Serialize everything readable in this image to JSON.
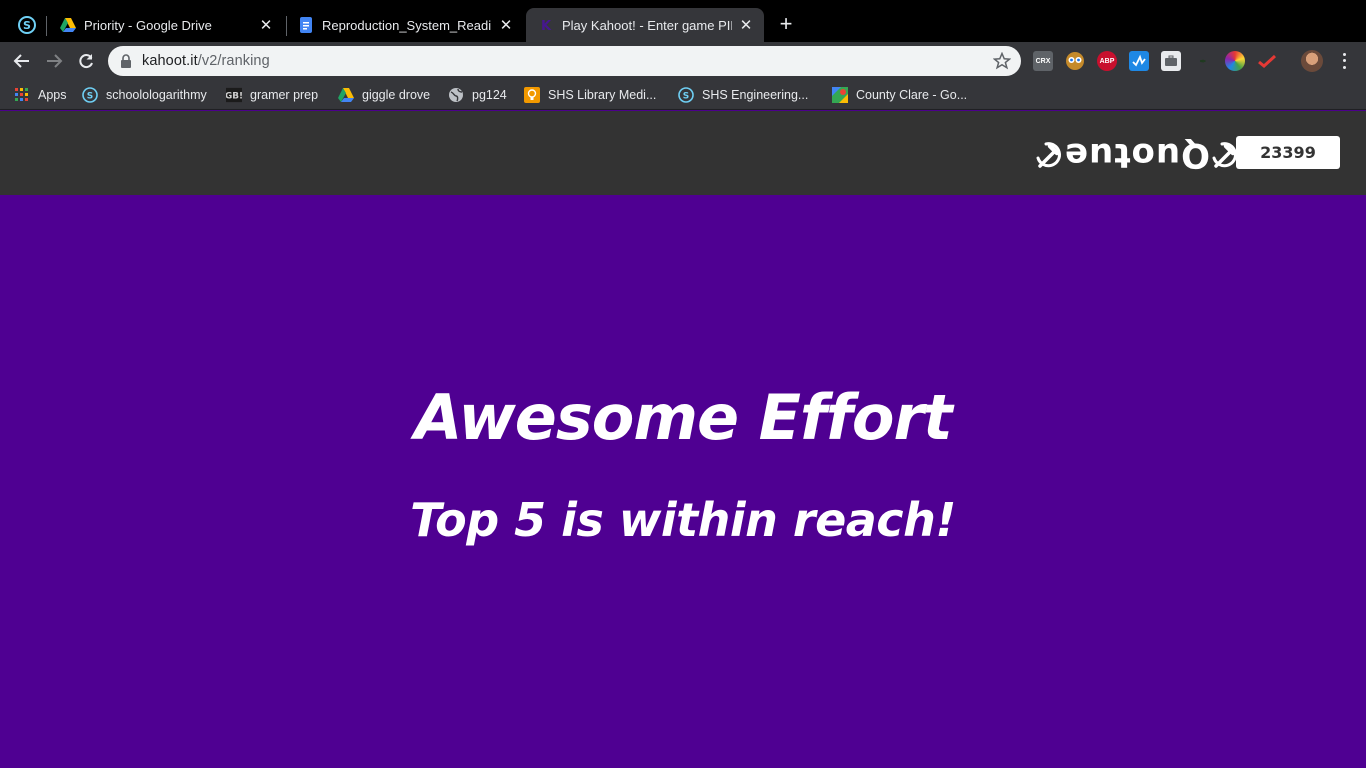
{
  "browser": {
    "tabs": [
      {
        "title": "Priority - Google Drive",
        "icon": "google-drive-icon"
      },
      {
        "title": "Reproduction_System_Reading",
        "icon": "google-docs-icon"
      },
      {
        "title": "Play Kahoot! - Enter game PIN",
        "icon": "kahoot-icon",
        "active": true
      }
    ],
    "url_host": "kahoot.it",
    "url_path": "/v2/ranking",
    "extensions": [
      "CRX",
      "ABP"
    ]
  },
  "bookmarks": [
    {
      "label": "Apps",
      "icon": "apps-grid-icon"
    },
    {
      "label": "schoolologarithmy",
      "icon": "schoology-icon"
    },
    {
      "label": "gramer prep",
      "icon": "gb-icon"
    },
    {
      "label": "giggle drove",
      "icon": "google-drive-icon"
    },
    {
      "label": "pg124",
      "icon": "globe-icon"
    },
    {
      "label": "SHS Library Medi...",
      "icon": "bulb-icon"
    },
    {
      "label": "SHS Engineering...",
      "icon": "schoology-icon"
    },
    {
      "label": "County Clare - Go...",
      "icon": "google-maps-icon"
    }
  ],
  "game": {
    "nickname": "Quotue",
    "score": "23399",
    "headline": "Awesome Effort",
    "subheadline": "Top 5 is within reach!"
  },
  "colors": {
    "background": "#4f0092",
    "header": "#333333"
  }
}
